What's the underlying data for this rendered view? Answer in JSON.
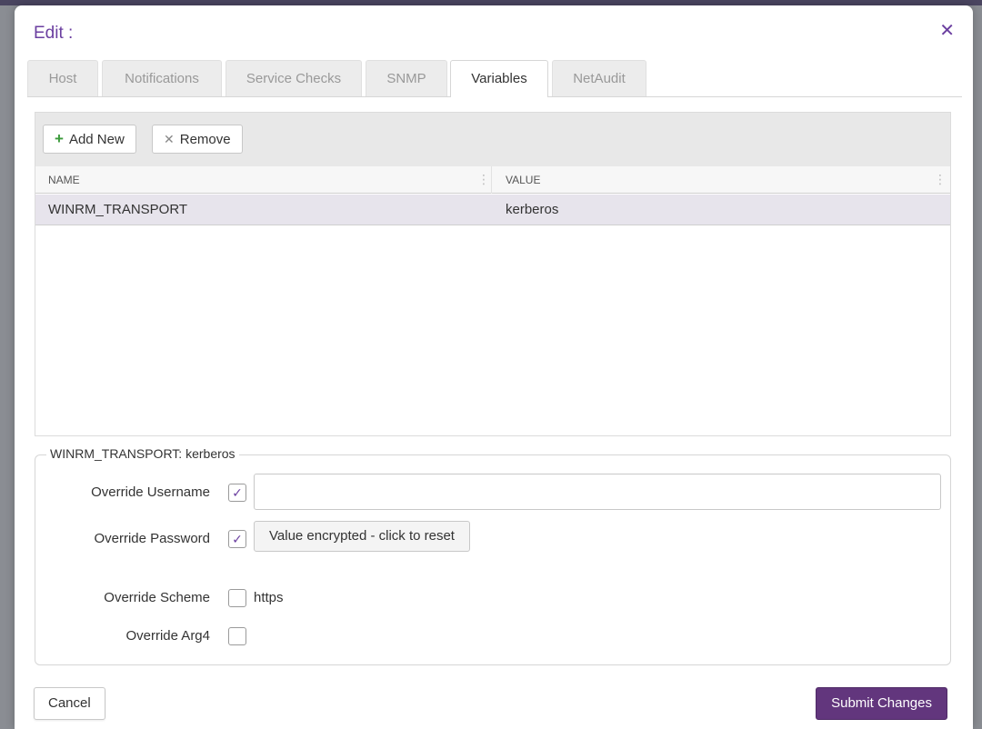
{
  "modal": {
    "title": "Edit :",
    "close_icon": "close-icon",
    "accent_color": "#6b3fa0"
  },
  "tabs": [
    {
      "label": "Host",
      "active": false
    },
    {
      "label": "Notifications",
      "active": false
    },
    {
      "label": "Service Checks",
      "active": false
    },
    {
      "label": "SNMP",
      "active": false
    },
    {
      "label": "Variables",
      "active": true
    },
    {
      "label": "NetAudit",
      "active": false
    }
  ],
  "toolbar": {
    "add_label": "Add New",
    "add_icon": "plus-icon",
    "remove_label": "Remove",
    "remove_icon": "x-icon"
  },
  "grid": {
    "columns": [
      "NAME",
      "VALUE"
    ],
    "rows": [
      {
        "name": "WINRM_TRANSPORT",
        "value": "kerberos",
        "selected": true
      }
    ]
  },
  "detail": {
    "legend": "WINRM_TRANSPORT: kerberos",
    "override_username": {
      "label": "Override Username",
      "checked": true,
      "value": ""
    },
    "override_password": {
      "label": "Override Password",
      "checked": true,
      "button_label": "Value encrypted - click to reset"
    },
    "override_scheme": {
      "label": "Override Scheme",
      "checked": false,
      "option_text": "https"
    },
    "override_arg4": {
      "label": "Override Arg4",
      "checked": false
    }
  },
  "footer": {
    "cancel_label": "Cancel",
    "submit_label": "Submit Changes",
    "submit_color": "#62367d"
  }
}
